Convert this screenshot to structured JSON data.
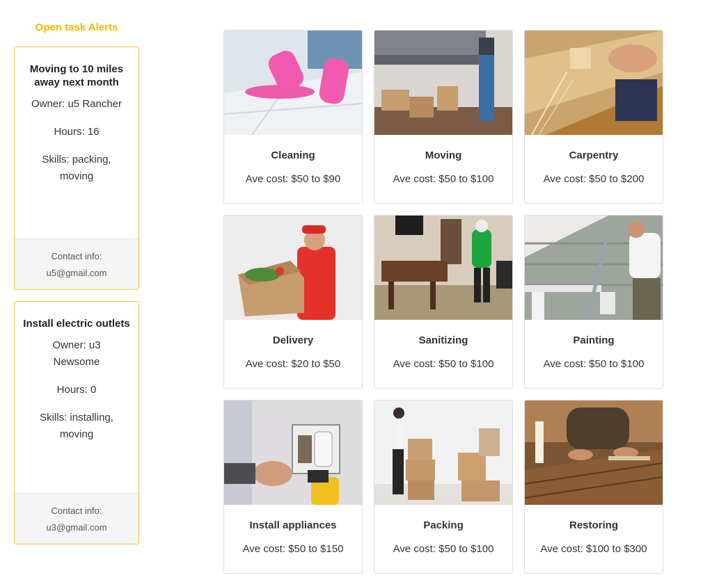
{
  "sidebar": {
    "title": "Open task Alerts",
    "alerts": [
      {
        "title": "Moving to 10 miles away next month",
        "owner": "Owner: u5 Rancher",
        "hours": "Hours: 16",
        "skills": "Skills: packing, moving",
        "contact_label": "Contact info:",
        "contact_email": "u5@gmail.com"
      },
      {
        "title": "Install electric outlets",
        "owner": "Owner: u3 Newsome",
        "hours": "Hours: 0",
        "skills": "Skills: installing, moving",
        "contact_label": "Contact info:",
        "contact_email": "u3@gmail.com"
      }
    ]
  },
  "services": [
    {
      "title": "Cleaning",
      "cost": "Ave cost: $50 to $90",
      "image": "cleaning-photo"
    },
    {
      "title": "Moving",
      "cost": "Ave cost: $50 to $100",
      "image": "moving-photo"
    },
    {
      "title": "Carpentry",
      "cost": "Ave cost: $50 to $200",
      "image": "carpentry-photo"
    },
    {
      "title": "Delivery",
      "cost": "Ave cost: $20 to $50",
      "image": "delivery-photo"
    },
    {
      "title": "Sanitizing",
      "cost": "Ave cost: $50 to $100",
      "image": "sanitizing-photo"
    },
    {
      "title": "Painting",
      "cost": "Ave cost: $50 to $100",
      "image": "painting-photo"
    },
    {
      "title": "Install appliances",
      "cost": "Ave cost: $50 to $150",
      "image": "install-appliances-photo"
    },
    {
      "title": "Packing",
      "cost": "Ave cost: $50 to $100",
      "image": "packing-photo"
    },
    {
      "title": "Restoring",
      "cost": "Ave cost: $100 to $300",
      "image": "restoring-photo"
    }
  ],
  "colors": {
    "accent": "#f5b800",
    "card_border": "#f5c431"
  }
}
